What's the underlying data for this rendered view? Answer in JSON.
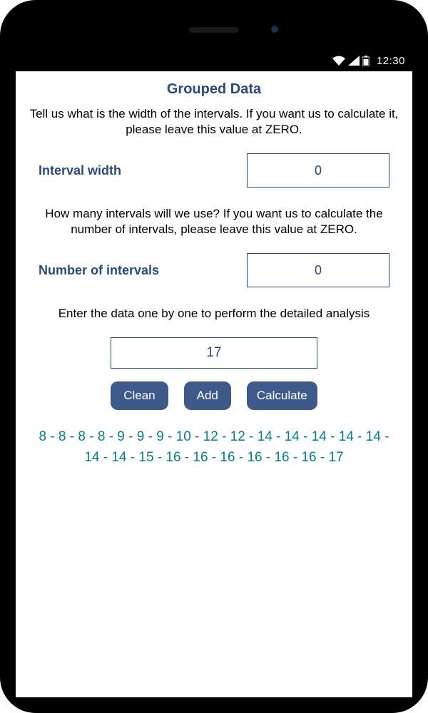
{
  "status_bar": {
    "time": "12:30"
  },
  "page": {
    "title": "Grouped Data",
    "instruction_width": "Tell us what is the width of the intervals. If you want us to calculate it, please leave this value at ZERO.",
    "label_width": "Interval width",
    "value_width": "0",
    "instruction_count": "How many intervals will we use? If you want us to calculate the number of intervals, please leave this value at ZERO.",
    "label_count": "Number of intervals",
    "value_count": "0",
    "instruction_data": "Enter the data one by one to perform the detailed analysis",
    "value_data": "17",
    "buttons": {
      "clean": "Clean",
      "add": "Add",
      "calculate": "Calculate"
    },
    "data_list": "8 - 8 - 8 - 8 - 9 - 9 - 9 - 10 - 12 - 12 - 14 - 14 - 14 - 14 - 14 - 14 - 14 - 15 - 16 - 16 - 16 - 16 - 16 - 16 - 17"
  }
}
